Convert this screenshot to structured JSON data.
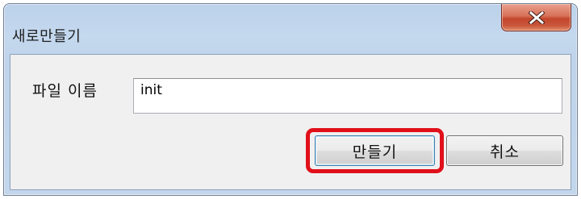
{
  "window": {
    "title": "새로만들기"
  },
  "titlebar": {
    "close_icon": "close-x-icon"
  },
  "form": {
    "label": "파일 이름",
    "input_value": "init"
  },
  "buttons": {
    "create_label": "만들기",
    "cancel_label": "취소"
  },
  "colors": {
    "highlight": "#e0101a",
    "close_button": "#c9553a"
  }
}
